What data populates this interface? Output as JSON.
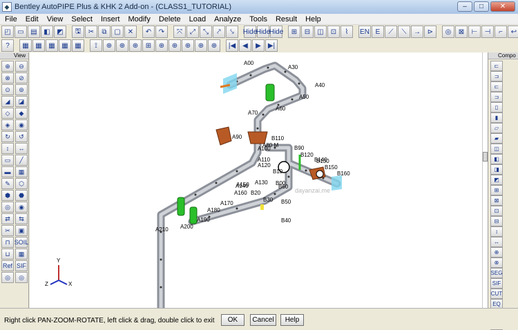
{
  "window": {
    "title": "Bentley AutoPIPE Plus & KHK 2 Add-on - (CLASS1_TUTORIAL)",
    "minimize": "–",
    "maximize": "□",
    "close": "✕"
  },
  "menu": [
    "File",
    "Edit",
    "View",
    "Select",
    "Insert",
    "Modify",
    "Delete",
    "Load",
    "Analyze",
    "Tools",
    "Result",
    "Help"
  ],
  "toolbar": {
    "row1": [
      "◰",
      "▭",
      "▤",
      "◧",
      "◩",
      "🖫",
      "✂",
      "⧉",
      "▢",
      "✕",
      "↶",
      "↷",
      "⤧",
      "⤢",
      "⤡",
      "⤤",
      "⤥",
      "Hide",
      "Hide",
      "Hide",
      "⊞",
      "⊟",
      "◫",
      "⊡",
      "⌇",
      "EN",
      "E",
      "⟋",
      "⟍",
      "→",
      "⊳",
      "◎",
      "⊠",
      "⊢",
      "⊣",
      "⌐",
      "↩"
    ],
    "row2": [
      "?",
      "▦",
      "▦",
      "▦",
      "▦",
      "▦",
      "⟟",
      "⊕",
      "⊕",
      "⊕",
      "⊞",
      "⊕",
      "⊕",
      "⊕",
      "⊕",
      "⊕",
      "|◀",
      "◀",
      "▶",
      "▶|"
    ]
  },
  "left_toolbar": {
    "header": "View",
    "buttons": [
      "⊕",
      "⊖",
      "⊗",
      "⊘",
      "⊙",
      "⊚",
      "◢",
      "◪",
      "◇",
      "◆",
      "◈",
      "◉",
      "↻",
      "↺",
      "↕",
      "↔",
      "▭",
      "╱",
      "▬",
      "▦",
      "✎",
      "⬡",
      "⬢",
      "⬣",
      "◎",
      "◉",
      "⇄",
      "⇆",
      "✂",
      "▣",
      "⊓",
      "SOIL",
      "⊔",
      "▦",
      "Ref",
      "SIF",
      "◎",
      "◎"
    ]
  },
  "right_toolbar": {
    "header": "Compo",
    "buttons": [
      "⊏",
      "⊐",
      "⊏",
      "⊐",
      "▯",
      "▮",
      "▱",
      "▰",
      "◫",
      "◧",
      "◨",
      "◩",
      "⊞",
      "⊠",
      "⊡",
      "⊟",
      "↕",
      "↔",
      "⊕",
      "⊗",
      "SEG",
      "SIF",
      "CUT",
      "EQ",
      "⊕",
      "⊗"
    ]
  },
  "model": {
    "nodes": [
      "A00",
      "A30",
      "A40",
      "A50",
      "A60",
      "A70",
      "A80 M",
      "A90",
      "A100",
      "A110",
      "A120",
      "A130",
      "A140",
      "A150",
      "A160",
      "A170",
      "A180",
      "A190",
      "A200",
      "A210",
      "B00",
      "B10",
      "B20",
      "B30",
      "B40",
      "B50",
      "B60",
      "B90",
      "B110",
      "B120",
      "B130",
      "B140",
      "B150",
      "B160"
    ],
    "watermark": "dayanzai.me",
    "axes": [
      "Y",
      "Z",
      "X"
    ]
  },
  "status": {
    "message": "Right click PAN-ZOOM-ROTATE, left click & drag, double click to exit",
    "ok": "OK",
    "cancel": "Cancel",
    "help": "Help"
  },
  "colors": {
    "pipe": "#b4b8bf",
    "support_green": "#2bbf2b",
    "valve_brown": "#b85a25",
    "anchor_cyan": "#7fd6ef"
  }
}
